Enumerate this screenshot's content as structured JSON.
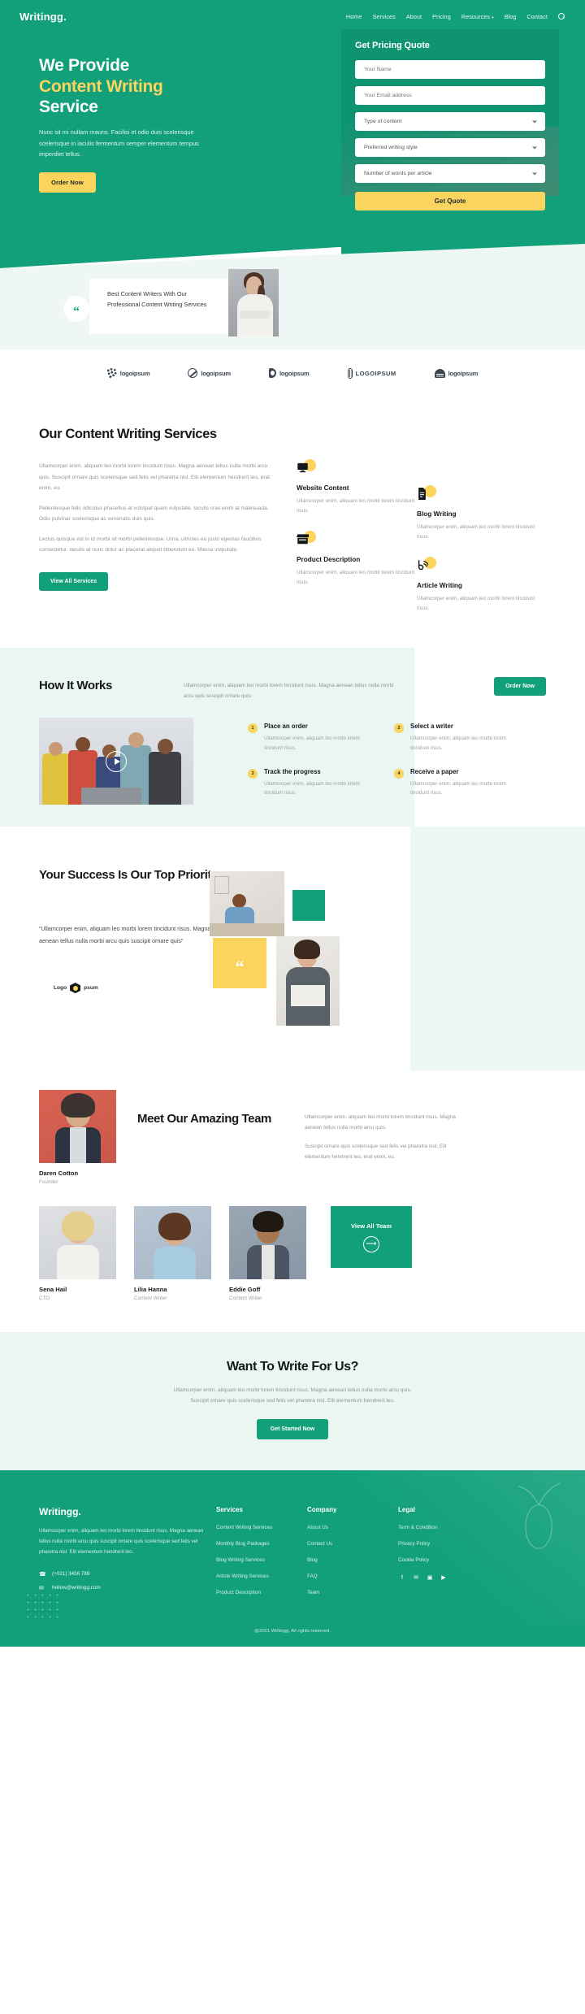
{
  "header": {
    "logo": "Writingg.",
    "nav": [
      {
        "label": "Home"
      },
      {
        "label": "Services"
      },
      {
        "label": "About"
      },
      {
        "label": "Pricing"
      },
      {
        "label": "Resources",
        "caret": "▾"
      },
      {
        "label": "Blog"
      },
      {
        "label": "Contact"
      }
    ],
    "search_icon": "search-icon"
  },
  "hero": {
    "title_line1": "We Provide",
    "title_highlight": "Content Writing",
    "title_line3": "Service",
    "paragraph": "Nunc sit mi nullam mauris. Facilisi et odio duis scelerisque scelerisque in iaculis fermentum semper elementum tempus imperdiet tellus.",
    "cta": "Order Now"
  },
  "quote_form": {
    "title": "Get Pricing Quote",
    "fields": [
      {
        "placeholder": "Your Name",
        "type": "text"
      },
      {
        "placeholder": "Your Email address",
        "type": "text"
      },
      {
        "placeholder": "Type of content",
        "type": "select"
      },
      {
        "placeholder": "Preferred writing style",
        "type": "select"
      },
      {
        "placeholder": "Number of words per article",
        "type": "select"
      }
    ],
    "submit": "Get Quote"
  },
  "testimonial": {
    "quote_mark": "“",
    "text": "Best Content Writers With Our Professional Content Writing Services"
  },
  "logos": [
    {
      "name": "logoipsum",
      "mark": "dots"
    },
    {
      "name": "logoipsum",
      "mark": "circle"
    },
    {
      "name": "logoipsum",
      "mark": "half"
    },
    {
      "name": "LOGOIPSUM",
      "mark": "bar"
    },
    {
      "name": "logoipsum",
      "mark": "wave"
    }
  ],
  "services": {
    "heading": "Our Content Writing Services",
    "paragraphs": [
      "Ullamcorper enim, aliquam leo morbi lorem tincidunt risus. Magna aenean tellus nulla morbi arcu quis. Suscipit ornare quis scelerisque sed felis vel pharetra nisl. Elit elementum hendrerit leo, erat enim, eu.",
      "Pellentesque felis ridiculus phasellus at volutpat quam vulputate. Iaculis cras enim at malesuada. Odio pulvinar scelerisque ac venenatis duis quis.",
      "Lectus quisque est in id morbi sit morbi pellentesque. Urna, ultricies eu justo egestas faucibus consectetur. Iaculis at nunc dolor ac placerat aliquet bibendum eu. Massa vulputate."
    ],
    "cta": "View All Services",
    "cards": [
      {
        "icon": "monitor-icon",
        "glyph": "▢",
        "title": "Website Content",
        "text": "Ullamcorper enim, aliquam leo morbi lorem tincidunt risus."
      },
      {
        "icon": "document-icon",
        "glyph": "▤",
        "title": "Blog Writing",
        "text": "Ullamcorper enim, aliquam leo morbi lorem tincidunt risus."
      },
      {
        "icon": "store-icon",
        "glyph": "⌂",
        "title": "Product Description",
        "text": "Ullamcorper enim, aliquam leo morbi lorem tincidunt risus."
      },
      {
        "icon": "rss-icon",
        "glyph": "♪",
        "title": "Article Writing",
        "text": "Ullamcorper enim, aliquam leo morbi lorem tincidunt risus."
      }
    ]
  },
  "how_it_works": {
    "heading": "How It Works",
    "intro": "Ullamcorper enim, aliquam leo morbi lorem tincidunt risus. Magna aenean tellus nulla morbi arcu quis suscipit ornare quis.",
    "cta": "Order Now",
    "play_icon": "play-icon",
    "steps": [
      {
        "num": "1",
        "title": "Place an order",
        "text": "Ullamcorper enim, aliquam leo morbi lorem tincidunt risus."
      },
      {
        "num": "2",
        "title": "Select a writer",
        "text": "Ullamcorper enim, aliquam leo morbi lorem tincidunt risus."
      },
      {
        "num": "3",
        "title": "Track the progress",
        "text": "Ullamcorper enim, aliquam leo morbi lorem tincidunt risus."
      },
      {
        "num": "4",
        "title": "Receive a paper",
        "text": "Ullamcorper enim, aliquam leo morbi lorem tincidunt risus."
      }
    ]
  },
  "success": {
    "heading": "Your Success Is Our Top Priority",
    "quote": "“Ullamcorper enim, aliquam leo morbi lorem tincidunt risus. Magna aenean tellus nulla morbi arcu quis suscipit ornare quis”",
    "brand_logo": "Logo    psum",
    "brand_logo_a": "Logo",
    "brand_logo_b": "psum",
    "quote_mark": "“"
  },
  "team": {
    "heading": "Meet Our Amazing Team",
    "paragraphs": [
      "Ullamcorper enim, aliquam leo morbi lorem tincidunt risus. Magna aenean tellus nulla morbi arcu quis.",
      "Suscipit ornare quis scelerisque sed felis vel pharetra nisl. Elit elementum hendrerit leo, erat enim, eu."
    ],
    "lead": {
      "name": "Daren Cotton",
      "role": "Founder"
    },
    "members": [
      {
        "name": "Sena Hail",
        "role": "CTO"
      },
      {
        "name": "Lilia Hanna",
        "role": "Content Writer"
      },
      {
        "name": "Eddie Goff",
        "role": "Content Writer"
      }
    ],
    "view_all": "View All Team",
    "arrow_icon": "arrow-right-icon"
  },
  "cta_section": {
    "heading": "Want To Write For Us?",
    "text_line1": "Ullamcorper enim, aliquam leo morbi lorem tincidunt risus. Magna aenean tellus nulla morbi arcu quis.",
    "text_line2": "Suscipit ornare quis scelerisque sed felis vel pharetra nisl. Elit elementum hendrerit leo.",
    "button": "Get Started Now"
  },
  "footer": {
    "logo": "Writingg.",
    "about": "Ullamcorper enim, aliquam leo morbi lorem tincidunt risus. Magna aenean tellus nulla morbi arcu quis suscipit ornare quis scelerisque sed felis vel pharetra nisl. Elit elementum hendrerit leo.",
    "phone": "(+021) 3456 789",
    "email": "hellow@writingg.com",
    "phone_icon": "phone-icon",
    "mail_icon": "mail-icon",
    "columns": [
      {
        "title": "Services",
        "links": [
          "Content Writing Services",
          "Monthly Blog Packages",
          "Blog Writing Services",
          "Article Writing Services",
          "Product Description"
        ]
      },
      {
        "title": "Company",
        "links": [
          "About Us",
          "Contact Us",
          "Blog",
          "FAQ",
          "Team"
        ]
      },
      {
        "title": "Legal",
        "links": [
          "Term & Condition",
          "Privacy Policy",
          "Cookie Policy"
        ]
      }
    ],
    "social": [
      {
        "name": "facebook-icon",
        "glyph": "f"
      },
      {
        "name": "twitter-icon",
        "glyph": "✉"
      },
      {
        "name": "instagram-icon",
        "glyph": "▣"
      },
      {
        "name": "youtube-icon",
        "glyph": "▶"
      }
    ],
    "copyright": "@2021 Writingg. All rights reserved."
  },
  "colors": {
    "brand_green": "#11a07a",
    "brand_green_dark": "#0f9471",
    "accent_yellow": "#fbd45e",
    "mint": "#eaf6f1"
  }
}
